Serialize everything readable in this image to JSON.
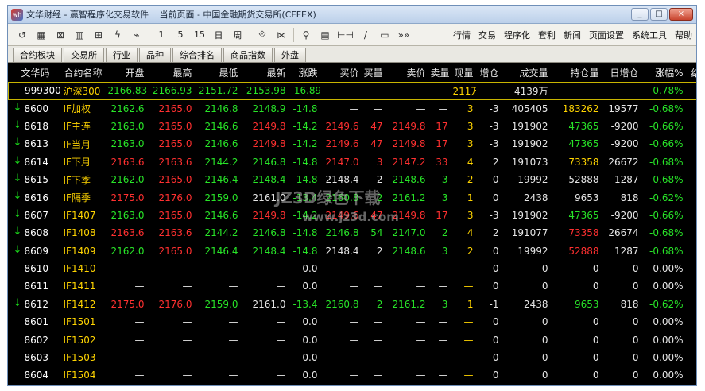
{
  "window": {
    "logo": "wh",
    "title_app": "文华财经 - 赢智程序化交易软件",
    "title_page": "当前页面 - 中国金融期货交易所(CFFEX)",
    "controls": [
      "_",
      "□",
      "×"
    ]
  },
  "toolbar": {
    "buttons": [
      {
        "name": "refresh-icon",
        "label": "↺"
      },
      {
        "name": "grid-icon",
        "label": "▦"
      },
      {
        "name": "trend-icon",
        "label": "⊠"
      },
      {
        "name": "chart-icon",
        "label": "▥"
      },
      {
        "name": "kline-icon",
        "label": "⊞"
      },
      {
        "name": "lightning-icon",
        "label": "ϟ"
      },
      {
        "name": "flow-icon",
        "label": "⌁"
      },
      {
        "name": "period-1",
        "label": "1"
      },
      {
        "name": "period-5",
        "label": "5"
      },
      {
        "name": "period-15",
        "label": "15"
      },
      {
        "name": "period-day",
        "label": "日"
      },
      {
        "name": "period-week",
        "label": "周"
      },
      {
        "name": "zoom-in-icon",
        "label": "⟐"
      },
      {
        "name": "zoom-out-icon",
        "label": "⋈"
      },
      {
        "name": "search-icon",
        "label": "⚲"
      },
      {
        "name": "calc-icon",
        "label": "▤"
      },
      {
        "name": "measure-icon",
        "label": "⊢⊣"
      },
      {
        "name": "line-icon",
        "label": "/"
      },
      {
        "name": "screen-icon",
        "label": "▭"
      },
      {
        "name": "more-icon",
        "label": "»»"
      }
    ],
    "menu": [
      "行情",
      "交易",
      "程序化",
      "套利",
      "新闻",
      "页面设置",
      "系统工具",
      "帮助"
    ]
  },
  "tabs": [
    "合约板块",
    "交易所",
    "行业",
    "品种",
    "综合排名",
    "商品指数",
    "外盘"
  ],
  "table": {
    "headers": [
      "文华码",
      "合约名称",
      "开盘",
      "最高",
      "最低",
      "最新",
      "涨跌",
      "买价",
      "买量",
      "卖价",
      "卖量",
      "现量",
      "增仓",
      "成交量",
      "持仓量",
      "日增仓",
      "涨幅%",
      "结算"
    ],
    "rows": [
      {
        "arrow": false,
        "hl": true,
        "cells": [
          "999300",
          "沪深300",
          "2166.83",
          "2166.93",
          "2151.72",
          "2153.98",
          "-16.89",
          "—",
          "—",
          "—",
          "—",
          "211万",
          "—",
          "4139万",
          "—",
          "—",
          "-0.78%",
          "—"
        ],
        "colors": [
          "",
          "",
          "dn",
          "dn",
          "dn",
          "dn",
          "dn",
          "wt",
          "wt",
          "wt",
          "wt",
          "yl",
          "wt",
          "wt",
          "wt",
          "wt",
          "dn",
          "wt"
        ]
      },
      {
        "arrow": true,
        "hl": false,
        "cells": [
          "8600",
          "IF加权",
          "2162.6",
          "2165.0",
          "2146.8",
          "2148.9",
          "-14.8",
          "—",
          "—",
          "—",
          "—",
          "3",
          "-3",
          "405405",
          "183262",
          "19577",
          "-0.68%",
          "—"
        ],
        "colors": [
          "",
          "",
          "dn",
          "up",
          "dn",
          "dn",
          "dn",
          "wt",
          "wt",
          "wt",
          "wt",
          "yl",
          "wt",
          "wt",
          "yl",
          "wt",
          "dn",
          "wt"
        ]
      },
      {
        "arrow": true,
        "hl": false,
        "cells": [
          "8618",
          "IF主连",
          "2163.0",
          "2165.0",
          "2146.6",
          "2149.8",
          "-14.2",
          "2149.6",
          "47",
          "2149.8",
          "17",
          "3",
          "-3",
          "191902",
          "47365",
          "-9200",
          "-0.66%",
          "—"
        ],
        "colors": [
          "",
          "",
          "dn",
          "up",
          "dn",
          "up",
          "dn",
          "up",
          "up",
          "up",
          "up",
          "yl",
          "wt",
          "wt",
          "dn",
          "wt",
          "dn",
          "wt"
        ]
      },
      {
        "arrow": true,
        "hl": false,
        "cells": [
          "8613",
          "IF当月",
          "2163.0",
          "2165.0",
          "2146.6",
          "2149.8",
          "-14.2",
          "2149.6",
          "47",
          "2149.8",
          "17",
          "3",
          "-3",
          "191902",
          "47365",
          "-9200",
          "-0.66%",
          "—"
        ],
        "colors": [
          "",
          "",
          "dn",
          "up",
          "dn",
          "up",
          "dn",
          "up",
          "up",
          "up",
          "up",
          "yl",
          "wt",
          "wt",
          "dn",
          "wt",
          "dn",
          "wt"
        ]
      },
      {
        "arrow": true,
        "hl": false,
        "cells": [
          "8614",
          "IF下月",
          "2163.6",
          "2163.6",
          "2144.2",
          "2146.8",
          "-14.8",
          "2147.0",
          "3",
          "2147.2",
          "33",
          "4",
          "2",
          "191073",
          "73358",
          "26672",
          "-0.68%",
          "—"
        ],
        "colors": [
          "",
          "",
          "up",
          "up",
          "dn",
          "dn",
          "dn",
          "up",
          "up",
          "up",
          "up",
          "yl",
          "wt",
          "wt",
          "yl",
          "wt",
          "dn",
          "wt"
        ]
      },
      {
        "arrow": true,
        "hl": false,
        "cells": [
          "8615",
          "IF下季",
          "2162.0",
          "2165.0",
          "2146.4",
          "2148.4",
          "-14.8",
          "2148.4",
          "2",
          "2148.6",
          "3",
          "2",
          "0",
          "19992",
          "52888",
          "1287",
          "-0.68%",
          "—"
        ],
        "colors": [
          "",
          "",
          "dn",
          "up",
          "dn",
          "dn",
          "dn",
          "wt",
          "wt",
          "dn",
          "dn",
          "yl",
          "wt",
          "wt",
          "wt",
          "wt",
          "dn",
          "wt"
        ]
      },
      {
        "arrow": true,
        "hl": false,
        "cells": [
          "8616",
          "IF隔季",
          "2175.0",
          "2176.0",
          "2159.0",
          "2161.0",
          "-13.4",
          "2160.8",
          "2",
          "2161.2",
          "3",
          "1",
          "0",
          "2438",
          "9653",
          "818",
          "-0.62%",
          "—"
        ],
        "colors": [
          "",
          "",
          "up",
          "up",
          "dn",
          "wt",
          "dn",
          "dn",
          "dn",
          "dn",
          "dn",
          "yl",
          "wt",
          "wt",
          "wt",
          "wt",
          "dn",
          "wt"
        ]
      },
      {
        "arrow": true,
        "hl": false,
        "cells": [
          "8607",
          "IF1407",
          "2163.0",
          "2165.0",
          "2146.6",
          "2149.8",
          "-14.2",
          "2149.6",
          "47",
          "2149.8",
          "17",
          "3",
          "-3",
          "191902",
          "47365",
          "-9200",
          "-0.66%",
          "—"
        ],
        "colors": [
          "",
          "",
          "dn",
          "up",
          "dn",
          "up",
          "dn",
          "up",
          "up",
          "up",
          "up",
          "yl",
          "wt",
          "wt",
          "dn",
          "wt",
          "dn",
          "wt"
        ]
      },
      {
        "arrow": true,
        "hl": false,
        "cells": [
          "8608",
          "IF1408",
          "2163.6",
          "2163.6",
          "2144.2",
          "2146.8",
          "-14.8",
          "2146.8",
          "54",
          "2147.0",
          "2",
          "4",
          "2",
          "191077",
          "73358",
          "26674",
          "-0.68%",
          "—"
        ],
        "colors": [
          "",
          "",
          "up",
          "up",
          "dn",
          "dn",
          "dn",
          "dn",
          "dn",
          "dn",
          "dn",
          "yl",
          "wt",
          "wt",
          "up",
          "wt",
          "dn",
          "wt"
        ]
      },
      {
        "arrow": true,
        "hl": false,
        "cells": [
          "8609",
          "IF1409",
          "2162.0",
          "2165.0",
          "2146.4",
          "2148.4",
          "-14.8",
          "2148.4",
          "2",
          "2148.6",
          "3",
          "2",
          "0",
          "19992",
          "52888",
          "1287",
          "-0.68%",
          "—"
        ],
        "colors": [
          "",
          "",
          "dn",
          "up",
          "dn",
          "dn",
          "dn",
          "wt",
          "wt",
          "dn",
          "dn",
          "yl",
          "wt",
          "wt",
          "up",
          "wt",
          "dn",
          "wt"
        ]
      },
      {
        "arrow": false,
        "hl": false,
        "cells": [
          "8610",
          "IF1410",
          "—",
          "—",
          "—",
          "—",
          "0.0",
          "—",
          "—",
          "—",
          "—",
          "—",
          "0",
          "0",
          "0",
          "0",
          "0.00%",
          "—"
        ],
        "colors": [
          "",
          "",
          "wt",
          "wt",
          "wt",
          "wt",
          "wt",
          "wt",
          "wt",
          "wt",
          "wt",
          "yl",
          "wt",
          "wt",
          "wt",
          "wt",
          "wt",
          "wt"
        ]
      },
      {
        "arrow": false,
        "hl": false,
        "cells": [
          "8611",
          "IF1411",
          "—",
          "—",
          "—",
          "—",
          "0.0",
          "—",
          "—",
          "—",
          "—",
          "—",
          "0",
          "0",
          "0",
          "0",
          "0.00%",
          "—"
        ],
        "colors": [
          "",
          "",
          "wt",
          "wt",
          "wt",
          "wt",
          "wt",
          "wt",
          "wt",
          "wt",
          "wt",
          "yl",
          "wt",
          "wt",
          "wt",
          "wt",
          "wt",
          "wt"
        ]
      },
      {
        "arrow": true,
        "hl": false,
        "cells": [
          "8612",
          "IF1412",
          "2175.0",
          "2176.0",
          "2159.0",
          "2161.0",
          "-13.4",
          "2160.8",
          "2",
          "2161.2",
          "3",
          "1",
          "-1",
          "2438",
          "9653",
          "818",
          "-0.62%",
          "—"
        ],
        "colors": [
          "",
          "",
          "up",
          "up",
          "dn",
          "wt",
          "dn",
          "dn",
          "dn",
          "dn",
          "dn",
          "yl",
          "wt",
          "wt",
          "dn",
          "wt",
          "dn",
          "wt"
        ]
      },
      {
        "arrow": false,
        "hl": false,
        "cells": [
          "8601",
          "IF1501",
          "—",
          "—",
          "—",
          "—",
          "0.0",
          "—",
          "—",
          "—",
          "—",
          "—",
          "0",
          "0",
          "0",
          "0",
          "0.00%",
          "—"
        ],
        "colors": [
          "",
          "",
          "wt",
          "wt",
          "wt",
          "wt",
          "wt",
          "wt",
          "wt",
          "wt",
          "wt",
          "yl",
          "wt",
          "wt",
          "wt",
          "wt",
          "wt",
          "wt"
        ]
      },
      {
        "arrow": false,
        "hl": false,
        "cells": [
          "8602",
          "IF1502",
          "—",
          "—",
          "—",
          "—",
          "0.0",
          "—",
          "—",
          "—",
          "—",
          "—",
          "0",
          "0",
          "0",
          "0",
          "0.00%",
          "—"
        ],
        "colors": [
          "",
          "",
          "wt",
          "wt",
          "wt",
          "wt",
          "wt",
          "wt",
          "wt",
          "wt",
          "wt",
          "yl",
          "wt",
          "wt",
          "wt",
          "wt",
          "wt",
          "wt"
        ]
      },
      {
        "arrow": false,
        "hl": false,
        "cells": [
          "8603",
          "IF1503",
          "—",
          "—",
          "—",
          "—",
          "0.0",
          "—",
          "—",
          "—",
          "—",
          "—",
          "0",
          "0",
          "0",
          "0",
          "0.00%",
          "—"
        ],
        "colors": [
          "",
          "",
          "wt",
          "wt",
          "wt",
          "wt",
          "wt",
          "wt",
          "wt",
          "wt",
          "wt",
          "yl",
          "wt",
          "wt",
          "wt",
          "wt",
          "wt",
          "wt"
        ]
      },
      {
        "arrow": false,
        "hl": false,
        "cells": [
          "8604",
          "IF1504",
          "—",
          "—",
          "—",
          "—",
          "0.0",
          "—",
          "—",
          "—",
          "—",
          "—",
          "0",
          "0",
          "0",
          "0",
          "0.00%",
          "—"
        ],
        "colors": [
          "",
          "",
          "wt",
          "wt",
          "wt",
          "wt",
          "wt",
          "wt",
          "wt",
          "wt",
          "wt",
          "yl",
          "wt",
          "wt",
          "wt",
          "wt",
          "wt",
          "wt"
        ]
      }
    ]
  },
  "watermark": {
    "line1": "JZ3D绿色下载",
    "line2": "www.jz3d.com"
  }
}
